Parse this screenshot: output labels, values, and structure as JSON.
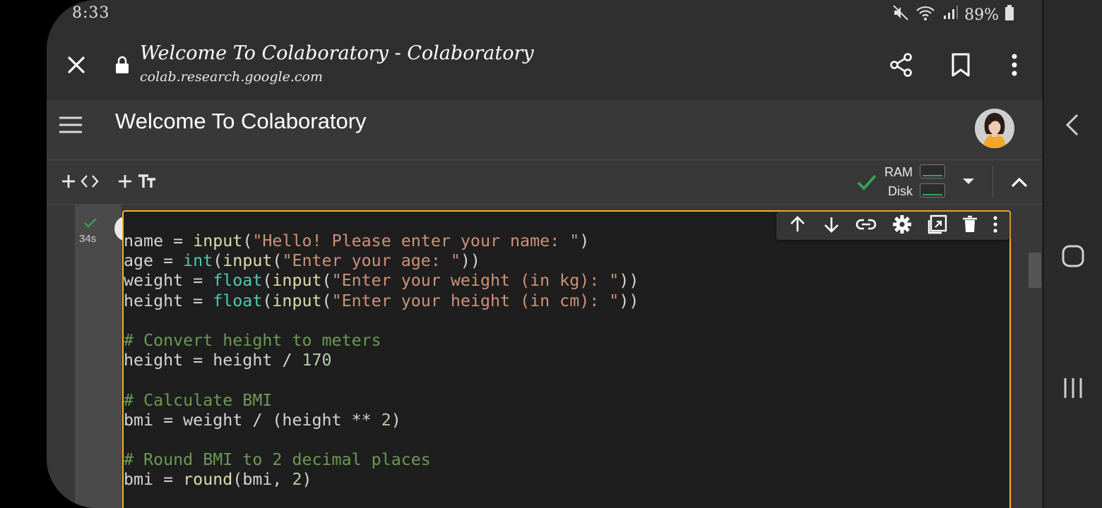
{
  "status_bar": {
    "time": "8:33",
    "battery": "89%"
  },
  "browser": {
    "page_title": "Welcome To Colaboratory - Colaboratory",
    "url": "colab.research.google.com"
  },
  "colab": {
    "notebook_title": "Welcome To Colaboratory",
    "toolbar": {
      "ram_label": "RAM",
      "disk_label": "Disk"
    },
    "cell": {
      "exec_time": "34s",
      "code_lines": [
        [
          {
            "t": "name = "
          },
          {
            "t": "input",
            "c": "fn"
          },
          {
            "t": "("
          },
          {
            "t": "\"Hello! Please enter your name: \"",
            "c": "str"
          },
          {
            "t": ")"
          }
        ],
        [
          {
            "t": "age = "
          },
          {
            "t": "int",
            "c": "type"
          },
          {
            "t": "("
          },
          {
            "t": "input",
            "c": "fn"
          },
          {
            "t": "("
          },
          {
            "t": "\"Enter your age: \"",
            "c": "str"
          },
          {
            "t": "))"
          }
        ],
        [
          {
            "t": "weight = "
          },
          {
            "t": "float",
            "c": "type"
          },
          {
            "t": "("
          },
          {
            "t": "input",
            "c": "fn"
          },
          {
            "t": "("
          },
          {
            "t": "\"Enter your weight (in kg): \"",
            "c": "str"
          },
          {
            "t": "))"
          }
        ],
        [
          {
            "t": "height = "
          },
          {
            "t": "float",
            "c": "type"
          },
          {
            "t": "("
          },
          {
            "t": "input",
            "c": "fn"
          },
          {
            "t": "("
          },
          {
            "t": "\"Enter your height (in cm): \"",
            "c": "str"
          },
          {
            "t": "))"
          }
        ],
        [],
        [
          {
            "t": "# Convert height to meters",
            "c": "cmt"
          }
        ],
        [
          {
            "t": "height = height / "
          },
          {
            "t": "170",
            "c": "num"
          }
        ],
        [],
        [
          {
            "t": "# Calculate BMI",
            "c": "cmt"
          }
        ],
        [
          {
            "t": "bmi = weight / (height ** "
          },
          {
            "t": "2",
            "c": "num"
          },
          {
            "t": ")"
          }
        ],
        [],
        [
          {
            "t": "# Round BMI to 2 decimal places",
            "c": "cmt"
          }
        ],
        [
          {
            "t": "bmi = "
          },
          {
            "t": "round",
            "c": "fn"
          },
          {
            "t": "(bmi, "
          },
          {
            "t": "2",
            "c": "num"
          },
          {
            "t": ")"
          }
        ]
      ]
    }
  },
  "icons": [
    "close-icon",
    "lock-icon",
    "share-icon",
    "bookmark-icon",
    "more-vert-icon",
    "menu-icon",
    "add-code-icon",
    "add-text-icon",
    "check-icon",
    "dropdown-icon",
    "collapse-icon",
    "run-icon",
    "move-up-icon",
    "move-down-icon",
    "link-icon",
    "settings-icon",
    "mirror-cell-icon",
    "delete-icon",
    "back-nav-icon",
    "home-nav-icon",
    "recents-nav-icon"
  ],
  "colors": {
    "accent_border": "#f5b32b",
    "success": "#34a853",
    "background": "#2f2f2f",
    "code_bg": "#1e1e1e"
  }
}
